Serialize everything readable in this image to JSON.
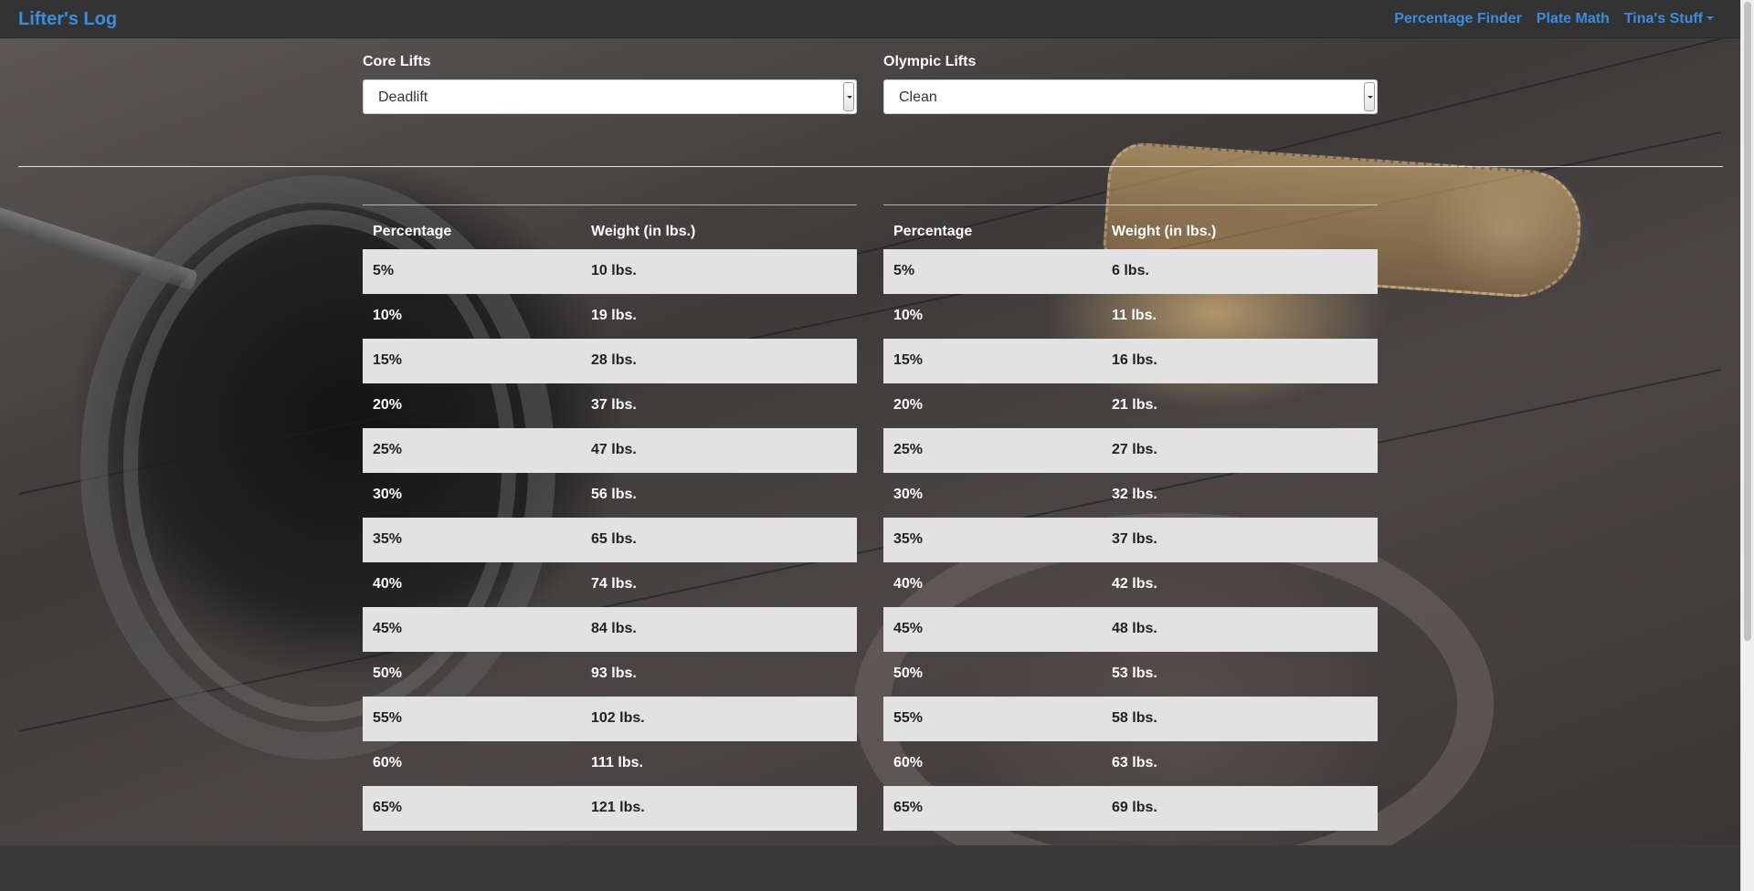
{
  "navbar": {
    "brand": "Lifter's Log",
    "links": [
      "Percentage Finder",
      "Plate Math",
      "Tina's Stuff"
    ]
  },
  "core": {
    "label": "Core Lifts",
    "selected": "Deadlift",
    "headers": [
      "Percentage",
      "Weight (in lbs.)"
    ],
    "rows": [
      [
        "5%",
        "10 lbs."
      ],
      [
        "10%",
        "19 lbs."
      ],
      [
        "15%",
        "28 lbs."
      ],
      [
        "20%",
        "37 lbs."
      ],
      [
        "25%",
        "47 lbs."
      ],
      [
        "30%",
        "56 lbs."
      ],
      [
        "35%",
        "65 lbs."
      ],
      [
        "40%",
        "74 lbs."
      ],
      [
        "45%",
        "84 lbs."
      ],
      [
        "50%",
        "93 lbs."
      ],
      [
        "55%",
        "102 lbs."
      ],
      [
        "60%",
        "111 lbs."
      ],
      [
        "65%",
        "121 lbs."
      ]
    ]
  },
  "olympic": {
    "label": "Olympic Lifts",
    "selected": "Clean",
    "headers": [
      "Percentage",
      "Weight (in lbs.)"
    ],
    "rows": [
      [
        "5%",
        "6 lbs."
      ],
      [
        "10%",
        "11 lbs."
      ],
      [
        "15%",
        "16 lbs."
      ],
      [
        "20%",
        "21 lbs."
      ],
      [
        "25%",
        "27 lbs."
      ],
      [
        "30%",
        "32 lbs."
      ],
      [
        "35%",
        "37 lbs."
      ],
      [
        "40%",
        "42 lbs."
      ],
      [
        "45%",
        "48 lbs."
      ],
      [
        "50%",
        "53 lbs."
      ],
      [
        "55%",
        "58 lbs."
      ],
      [
        "60%",
        "63 lbs."
      ],
      [
        "65%",
        "69 lbs."
      ]
    ]
  },
  "colors": {
    "accent": "#3a8dde",
    "navbar": "#333333",
    "stripe": "#e2e2e2"
  }
}
